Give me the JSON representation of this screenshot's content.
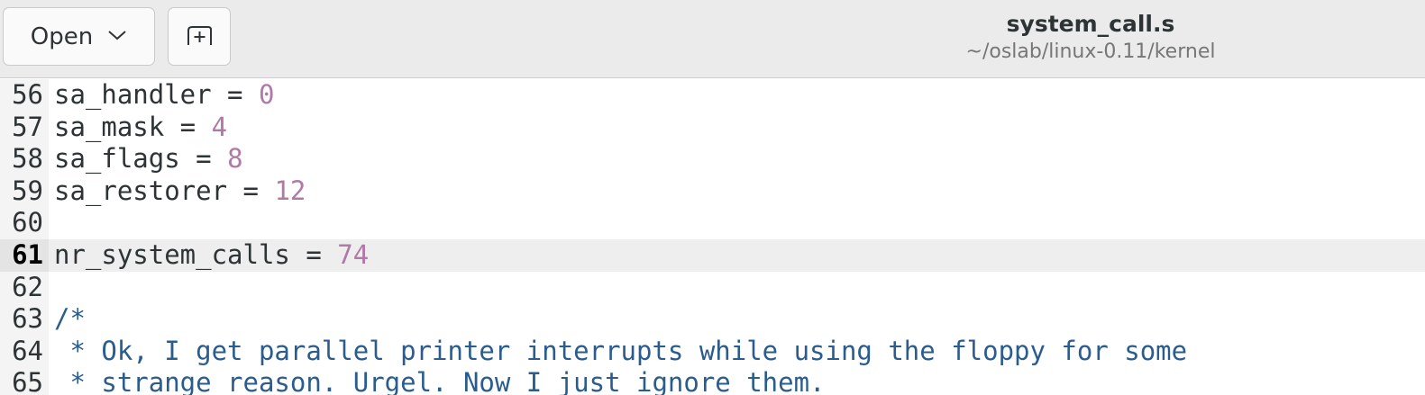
{
  "header": {
    "open_label": "Open",
    "title": "system_call.s",
    "subtitle": "~/oslab/linux-0.11/kernel"
  },
  "icons": {
    "open_dropdown": "chevron-down-icon",
    "new_tab": "new-tab-icon"
  },
  "colors": {
    "number": "#b07aa6",
    "comment": "#2a5c8e",
    "current_line": "#eeeeee"
  },
  "editor": {
    "current_line": "61",
    "lines": [
      {
        "num": "56",
        "text": "sa_handler = ",
        "value": "0"
      },
      {
        "num": "57",
        "text": "sa_mask = ",
        "value": "4"
      },
      {
        "num": "58",
        "text": "sa_flags = ",
        "value": "8"
      },
      {
        "num": "59",
        "text": "sa_restorer = ",
        "value": "12"
      },
      {
        "num": "60",
        "text": "",
        "value": ""
      },
      {
        "num": "61",
        "text": "nr_system_calls = ",
        "value": "74"
      },
      {
        "num": "62",
        "text": "",
        "value": ""
      },
      {
        "num": "63",
        "text": "/*",
        "value": ""
      },
      {
        "num": "64",
        "text": " * Ok, I get parallel printer interrupts while using the floppy for some",
        "value": ""
      },
      {
        "num": "65",
        "text": " * strange reason. Urgel. Now I just ignore them.",
        "value": ""
      }
    ]
  }
}
